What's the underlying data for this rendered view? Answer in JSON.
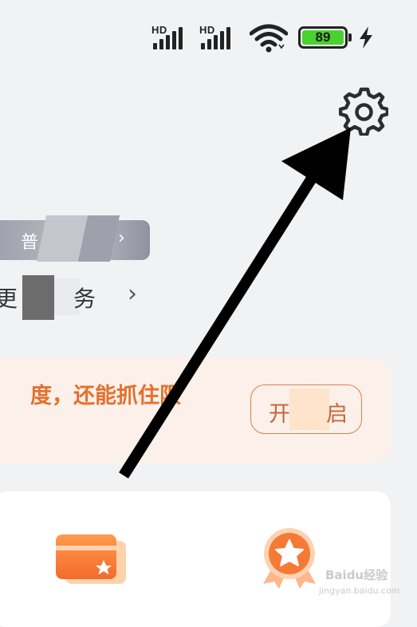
{
  "status_bar": {
    "signal_1_label": "HD",
    "signal_2_label": "HD",
    "battery_level": "89",
    "battery_color": "#49d12d",
    "icons": [
      "signal-icon",
      "signal-icon",
      "wifi-icon",
      "battery-icon",
      "charging-bolt-icon"
    ]
  },
  "header": {
    "settings_icon": "gear-icon"
  },
  "member_badge": {
    "level_text": "普",
    "chevron": "›"
  },
  "benefits_row": {
    "text_start": "更",
    "text_end": "务",
    "chevron": "›"
  },
  "promo_banner": {
    "text": "度，还能抓住限",
    "button_part_1": "开",
    "button_part_2": "启",
    "accent_color": "#e2712f",
    "background_color": "#fcf0ea"
  },
  "card": {
    "items": [
      {
        "icon": "card-star-icon"
      },
      {
        "icon": "medal-star-icon"
      }
    ]
  },
  "watermark": {
    "text": "Baidu经验",
    "sub": "jingyan.baidu.com"
  }
}
